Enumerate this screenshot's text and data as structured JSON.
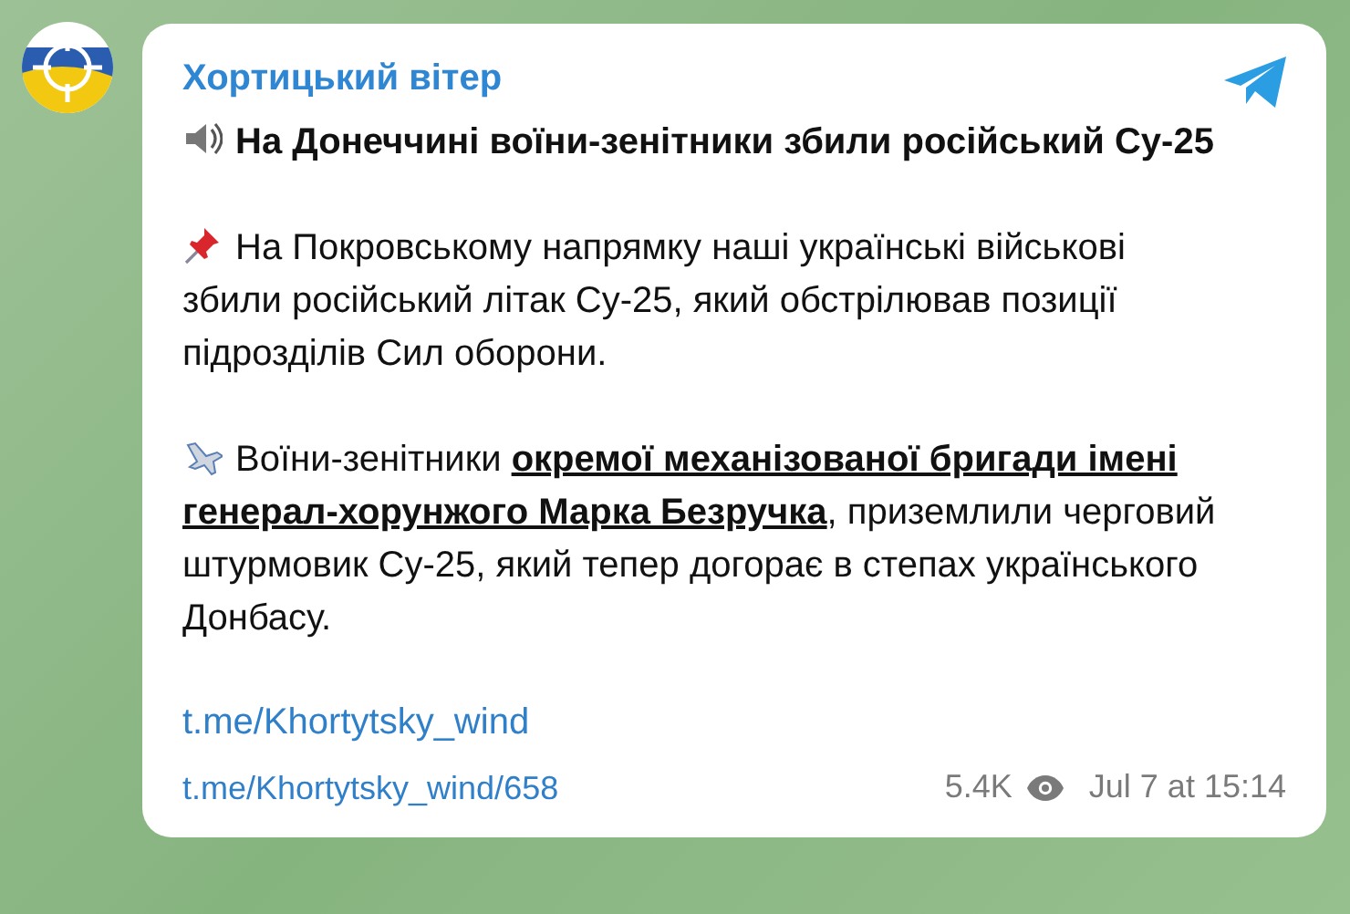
{
  "channel": {
    "name": "Хортицький вітер"
  },
  "post": {
    "paragraphs": [
      {
        "kind": "speaker",
        "text": "**На Донеччині воїни-зенітники збили російський Су-25**"
      },
      {
        "kind": "pin",
        "text": "На Покровському напрямку наші українські військові збили російський літак Су-25, який обстрілював позиції підрозділів Сил оборони."
      },
      {
        "kind": "plane",
        "text": "Воїни-зенітники **окремої механізованої бригади імені генерал-хорунжого Марка Безручка**, приземлили черговий штурмовик Су-25, який тепер догорає в степах українського Донбасу."
      }
    ],
    "link": "t.me/Khortytsky_wind"
  },
  "footer": {
    "post_link": "t.me/Khortytsky_wind/658",
    "views": "5.4K",
    "date": "Jul 7 at 15:14"
  }
}
